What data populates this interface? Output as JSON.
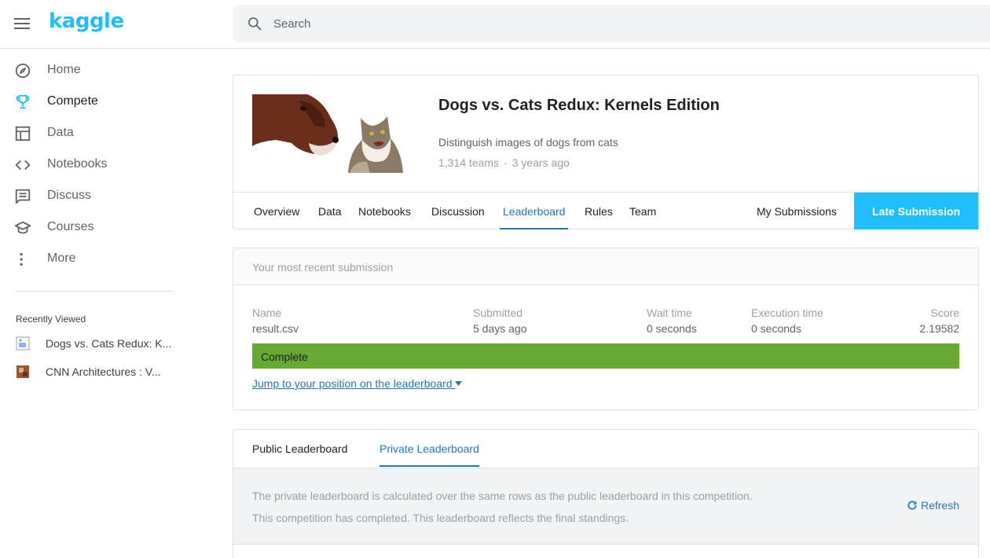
{
  "app": {
    "logo": "kaggle"
  },
  "search": {
    "placeholder": "Search"
  },
  "sidebar": {
    "items": [
      {
        "label": "Home",
        "icon": "compass-icon"
      },
      {
        "label": "Compete",
        "icon": "trophy-icon"
      },
      {
        "label": "Data",
        "icon": "table-icon"
      },
      {
        "label": "Notebooks",
        "icon": "code-icon"
      },
      {
        "label": "Discuss",
        "icon": "comment-icon"
      },
      {
        "label": "Courses",
        "icon": "school-icon"
      },
      {
        "label": "More",
        "icon": "more-vert-icon"
      }
    ],
    "recent_title": "Recently Viewed",
    "recent": [
      {
        "label": "Dogs vs. Cats Redux: K..."
      },
      {
        "label": "CNN Architectures : V..."
      }
    ]
  },
  "competition": {
    "title": "Dogs vs. Cats Redux: Kernels Edition",
    "subtitle": "Distinguish images of dogs from cats",
    "teams": "1,314 teams",
    "separator": "·",
    "age": "3 years ago",
    "tabs": [
      "Overview",
      "Data",
      "Notebooks",
      "Discussion",
      "Leaderboard",
      "Rules",
      "Team"
    ],
    "my_submissions": "My Submissions",
    "late_submission": "Late Submission"
  },
  "submission": {
    "header": "Your most recent submission",
    "labels": {
      "name": "Name",
      "submitted": "Submitted",
      "wait": "Wait time",
      "exec": "Execution time",
      "score": "Score"
    },
    "values": {
      "name": "result.csv",
      "submitted": "5 days ago",
      "wait": "0 seconds",
      "exec": "0 seconds",
      "score": "2.19582"
    },
    "status": "Complete",
    "jump_link": "Jump to your position on the leaderboard"
  },
  "leaderboard": {
    "tabs": [
      "Public Leaderboard",
      "Private Leaderboard"
    ],
    "line1": "The private leaderboard is calculated over the same rows as the public leaderboard in this competition.",
    "line2": "This competition has completed. This leaderboard reflects the final standings.",
    "refresh": "Refresh"
  },
  "colors": {
    "brand": "#20beff",
    "link": "#2577b1",
    "status_complete": "#66aa33"
  }
}
